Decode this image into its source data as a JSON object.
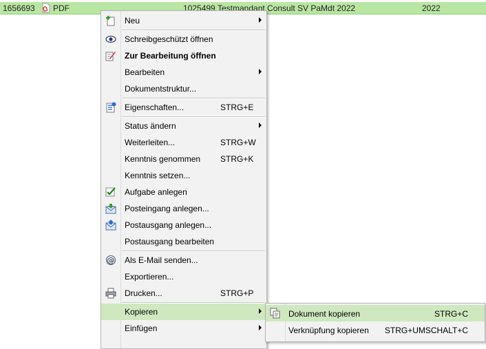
{
  "row": {
    "id": "1656693",
    "type": "PDF",
    "number": "1025499",
    "mandant": "Testmandant Consult",
    "name": "SV PaMdt 2022",
    "year": "2022"
  },
  "menu": {
    "neu": {
      "label": "Neu",
      "icon": "new-doc-icon"
    },
    "schreibgeschuetzt": {
      "label": "Schreibgeschützt öffnen",
      "icon": "eye-icon"
    },
    "zur_bearbeitung": {
      "label": "Zur Bearbeitung öffnen",
      "icon": "edit-doc-icon"
    },
    "bearbeiten": {
      "label": "Bearbeiten"
    },
    "dokumentstruktur": {
      "label": "Dokumentstruktur..."
    },
    "eigenschaften": {
      "label": "Eigenschaften...",
      "shortcut": "STRG+E",
      "icon": "properties-icon"
    },
    "status_aendern": {
      "label": "Status ändern"
    },
    "weiterleiten": {
      "label": "Weiterleiten...",
      "shortcut": "STRG+W"
    },
    "kenntnis_genommen": {
      "label": "Kenntnis genommen",
      "shortcut": "STRG+K"
    },
    "kenntnis_setzen": {
      "label": "Kenntnis setzen..."
    },
    "aufgabe_anlegen": {
      "label": "Aufgabe anlegen",
      "icon": "checkmark-icon"
    },
    "posteingang_anlegen": {
      "label": "Posteingang anlegen...",
      "icon": "inbox-icon"
    },
    "postausgang_anlegen": {
      "label": "Postausgang anlegen...",
      "icon": "outbox-icon"
    },
    "postausgang_bearbeiten": {
      "label": "Postausgang bearbeiten"
    },
    "email_senden": {
      "label": "Als E-Mail senden...",
      "icon": "at-icon"
    },
    "exportieren": {
      "label": "Exportieren..."
    },
    "drucken": {
      "label": "Drucken...",
      "shortcut": "STRG+P",
      "icon": "printer-icon"
    },
    "kopieren": {
      "label": "Kopieren"
    },
    "einfuegen": {
      "label": "Einfügen"
    }
  },
  "submenu": {
    "dokument_kopieren": {
      "label": "Dokument kopieren",
      "shortcut": "STRG+C",
      "icon": "copy-icon"
    },
    "verknuepfung_kopieren": {
      "label": "Verknüpfung kopieren",
      "shortcut": "STRG+UMSCHALT+C"
    }
  },
  "colors": {
    "selection": "#b9e6a2",
    "highlight": "#cfe8bf",
    "menu_bg": "#f2f2f2"
  }
}
